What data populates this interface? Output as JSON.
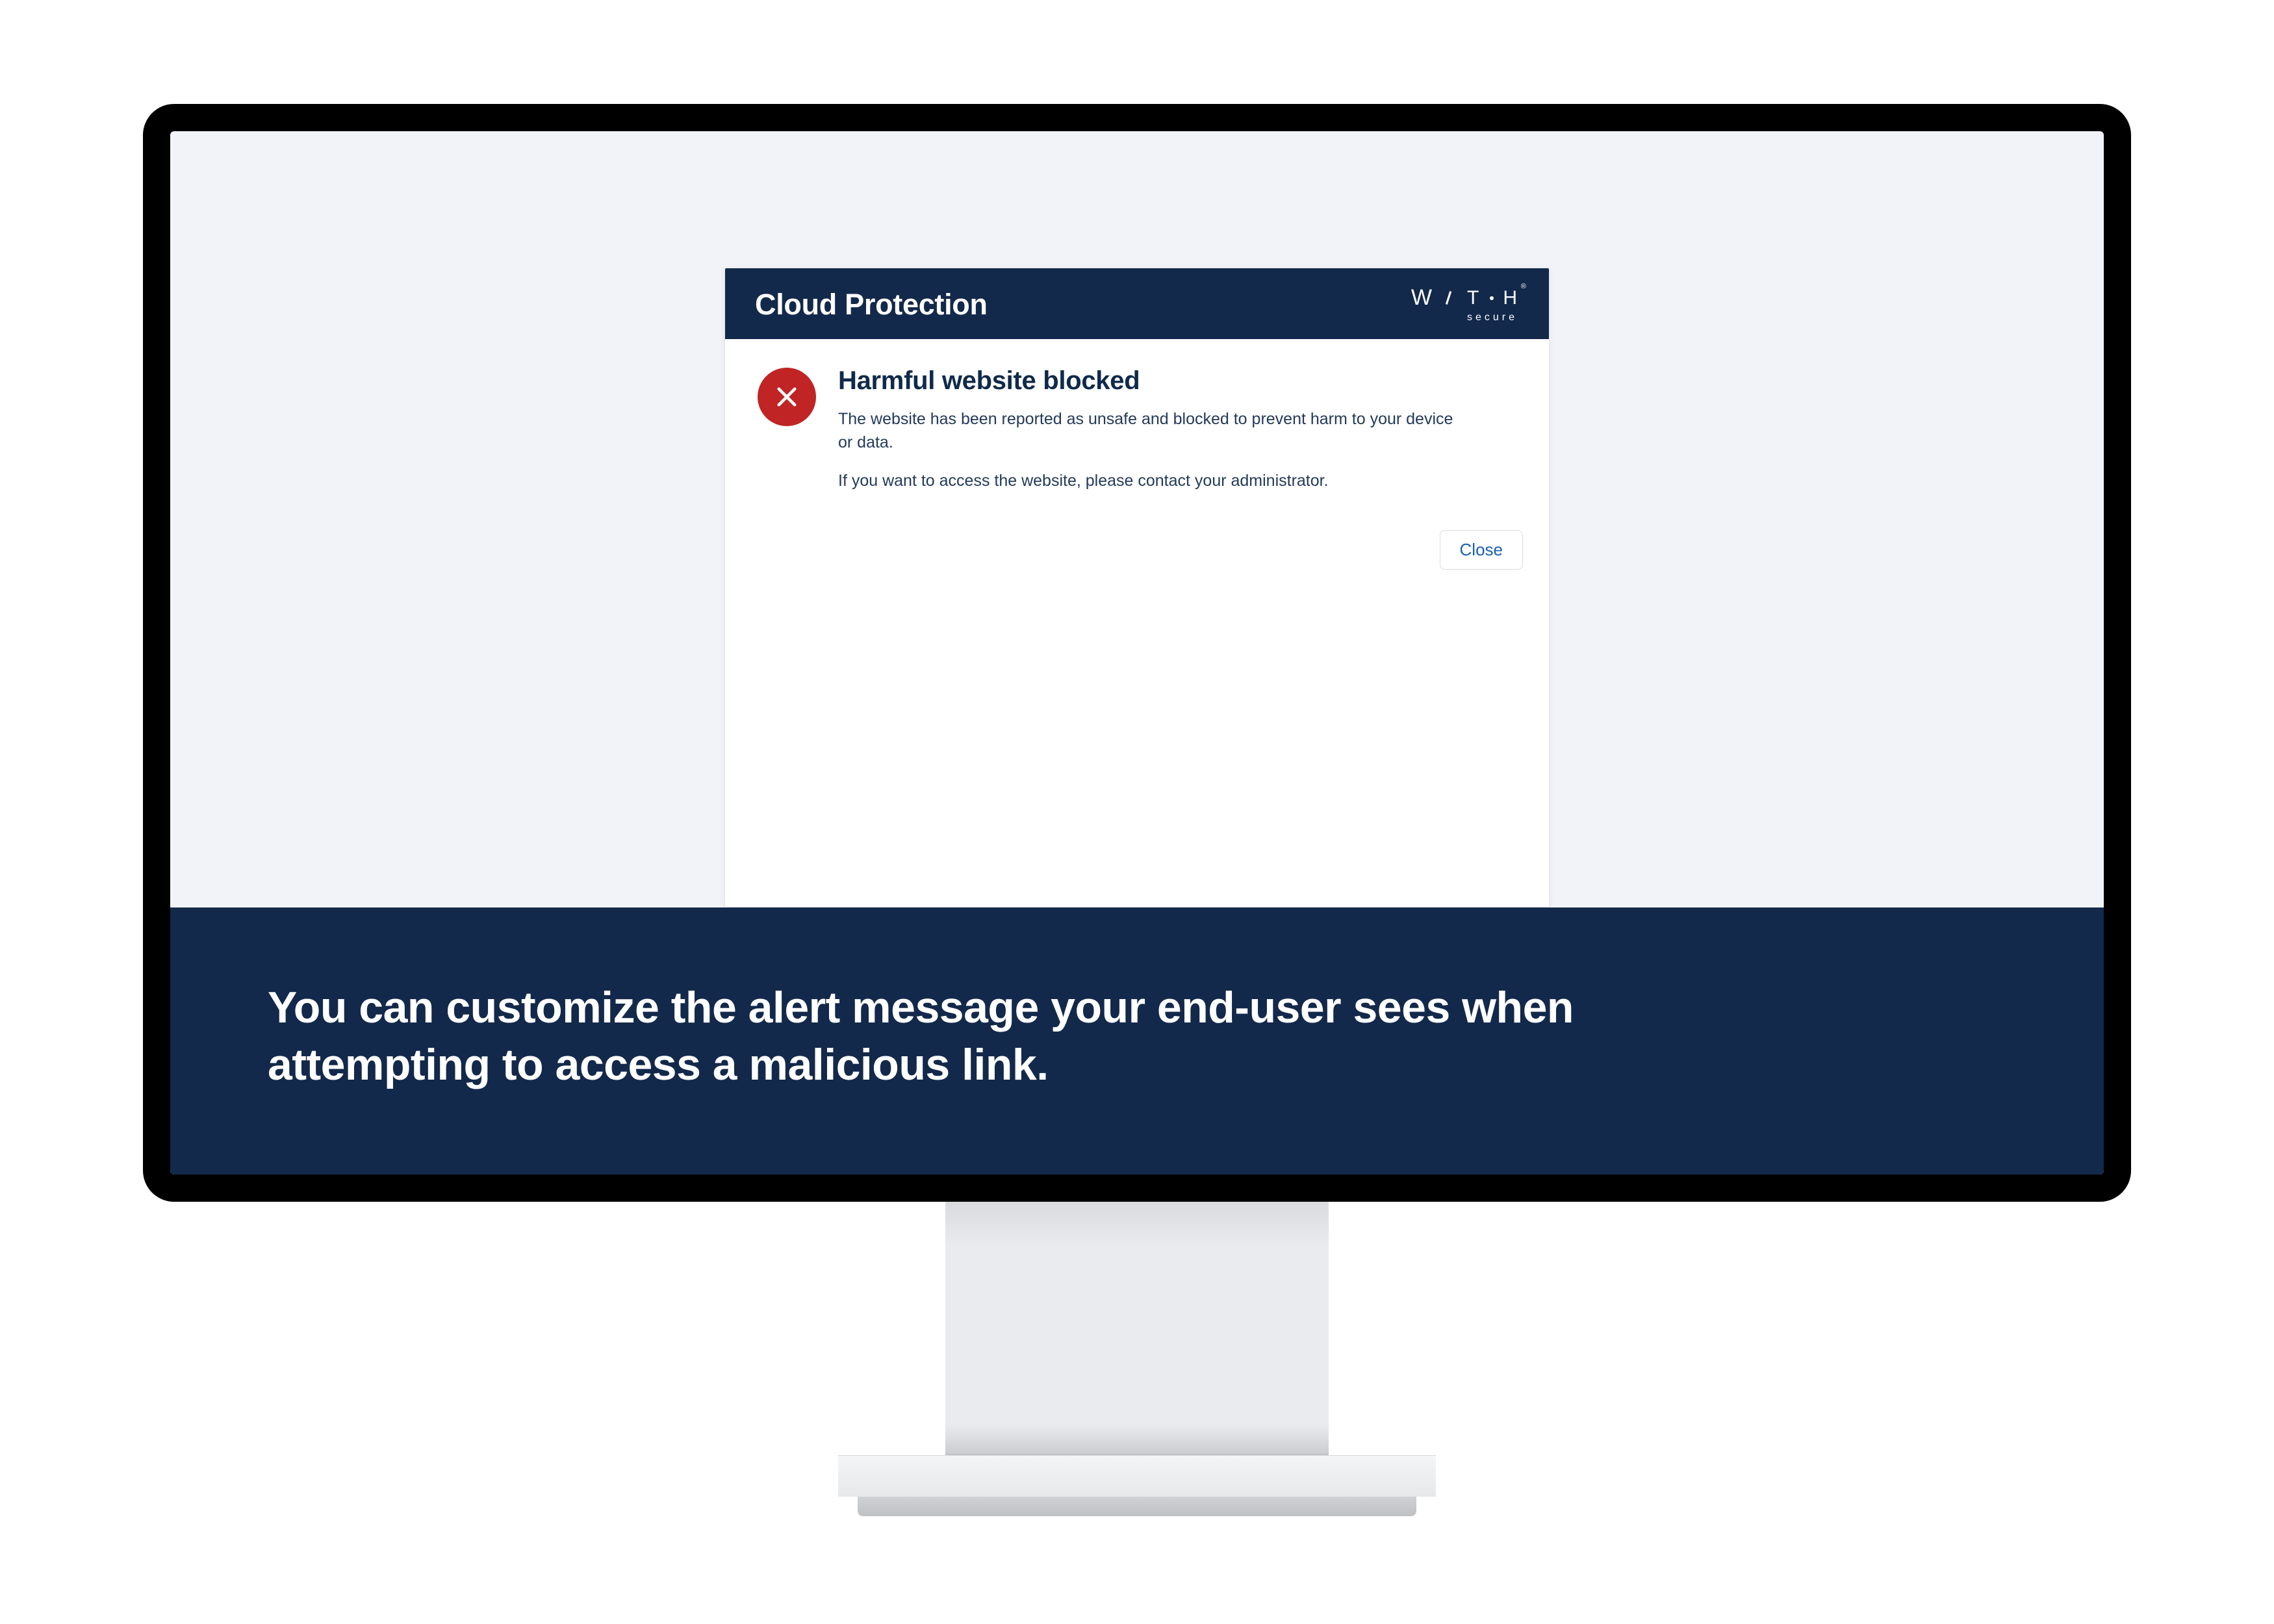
{
  "dialog": {
    "header_title": "Cloud Protection",
    "brand": {
      "letters": [
        "W",
        "T",
        "H"
      ],
      "subtext": "secure",
      "registered": "®"
    },
    "message": {
      "title": "Harmful website blocked",
      "line1": "The website has been reported as unsafe and blocked to prevent harm to your device or data.",
      "line2": "If you want to access the website, please contact your administrator."
    },
    "close_label": "Close"
  },
  "banner": {
    "text": "You can customize the alert message your end-user sees when attempting to access a malicious link."
  },
  "colors": {
    "navy": "#13294b",
    "error": "#c02424",
    "screen_bg": "#f1f3f9",
    "link": "#1b5fb3"
  }
}
